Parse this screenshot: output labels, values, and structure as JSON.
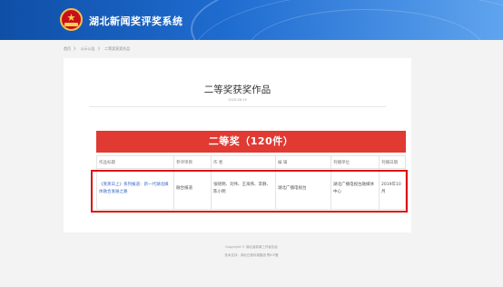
{
  "header": {
    "site_title": "湖北新闻奖评奖系统",
    "emblem_icon": "badge-emblem-icon",
    "colors": {
      "banner_start": "#0f4fa6",
      "banner_end": "#5fa4ee",
      "emblem_red": "#c8101a",
      "emblem_gold": "#f1c04a"
    }
  },
  "breadcrumb": {
    "items": [
      "首页",
      "》",
      "公示公告",
      "》",
      "二等奖获奖作品"
    ]
  },
  "article": {
    "title": "二等奖获奖作品",
    "date": "2020-08-19"
  },
  "award": {
    "banner": "二等奖（120件）",
    "banner_color": "#e03a33",
    "columns": [
      "作品标题",
      "参评项目",
      "作 者",
      "编 辑",
      "刊播单位",
      "刊播日期"
    ],
    "rows": [
      [
        "《蒸蒸日上》系列报道：新一代湖北媒体融合发展之路",
        "融合报道",
        "张晓明、刘伟、王海燕、李静、陈小明",
        "湖北广播电视台",
        "湖北广播电视台融媒体中心",
        "2019年10月"
      ]
    ],
    "highlight_color": "#dd1111"
  },
  "footer": {
    "lines": [
      "Copyright © 湖北省新闻工作者协会",
      "技术支持：湖北日报传媒集团 鄂ICP备"
    ]
  }
}
